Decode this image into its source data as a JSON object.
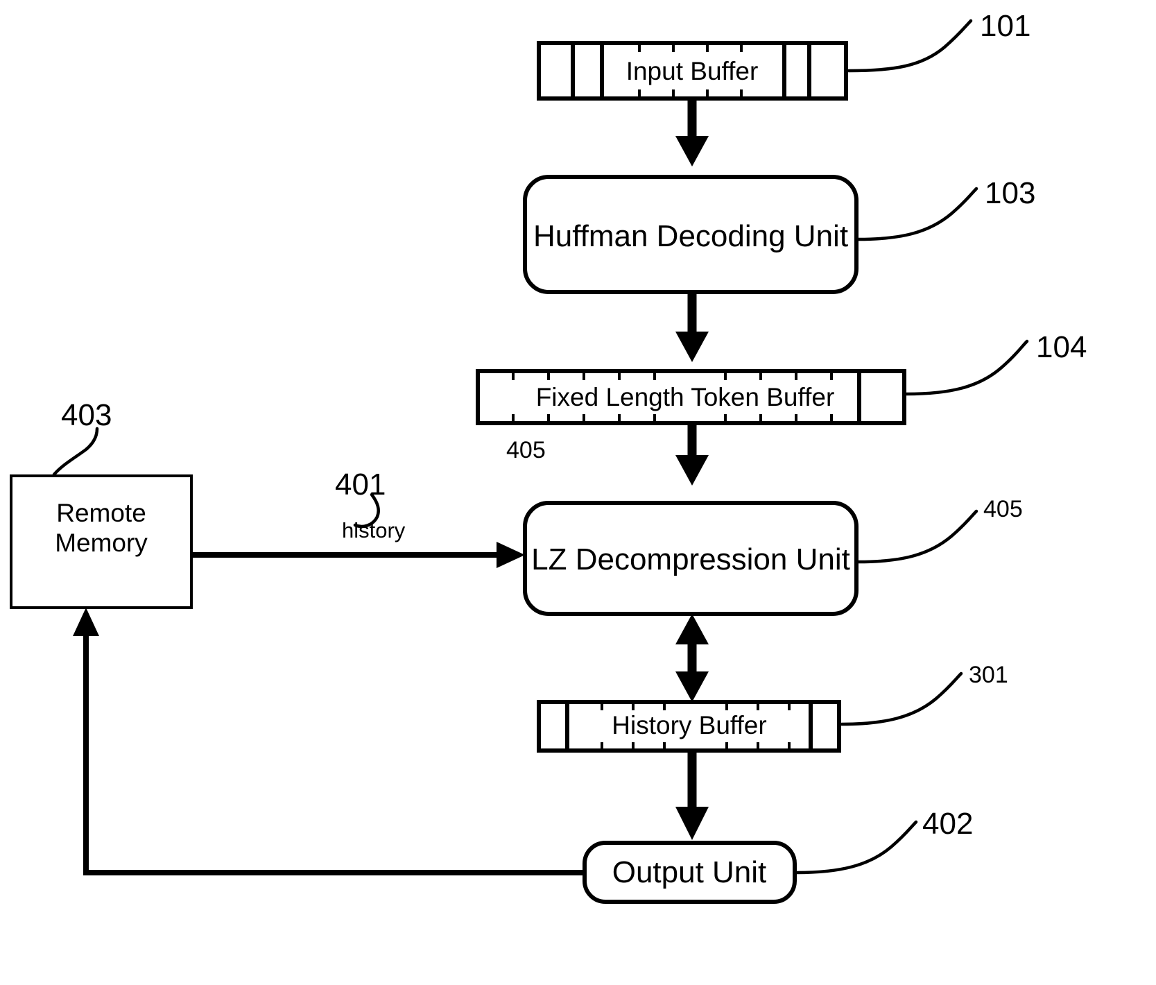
{
  "diagram": {
    "title": "LZ/Huffman Decompression Pipeline Block Diagram",
    "background_color": "#ffffff",
    "line_color": "#000000"
  },
  "blocks": {
    "input_buffer": {
      "label": "Input Buffer",
      "shape": "segmented-rectangle",
      "ref": "101"
    },
    "huffman_unit": {
      "label": "Huffman Decoding Unit",
      "shape": "rounded-rectangle",
      "ref": "103"
    },
    "token_buffer": {
      "label": "Fixed Length Token Buffer",
      "shape": "segmented-rectangle",
      "ref": "104"
    },
    "lz_unit": {
      "label": "LZ Decompression Unit",
      "shape": "rounded-rectangle",
      "ref": "405"
    },
    "history_buffer": {
      "label": "History Buffer",
      "shape": "segmented-rectangle",
      "ref": "301"
    },
    "output_unit": {
      "label": "Output Unit",
      "shape": "rounded-rectangle",
      "ref": "402"
    },
    "remote_memory": {
      "label_line1": "Remote",
      "label_line2": "Memory",
      "shape": "rectangle",
      "ref": "403"
    }
  },
  "reference_numerals": {
    "input_buffer": "101",
    "huffman_unit": "103",
    "token_buffer": "104",
    "token_buffer_lower": "405",
    "lz_unit": "405",
    "history_buffer": "301",
    "output_unit": "402",
    "remote_memory": "403",
    "history_path": "401"
  },
  "annotations": {
    "history_label": "history"
  },
  "connections": [
    {
      "from": "input_buffer",
      "to": "huffman_unit",
      "style": "thick-arrow-down"
    },
    {
      "from": "huffman_unit",
      "to": "token_buffer",
      "style": "thick-arrow-down"
    },
    {
      "from": "token_buffer",
      "to": "lz_unit",
      "style": "thick-arrow-down"
    },
    {
      "from": "remote_memory",
      "to": "lz_unit",
      "style": "arrow-right",
      "label": "history"
    },
    {
      "from": "lz_unit",
      "to": "history_buffer",
      "style": "thick-double-arrow-vertical"
    },
    {
      "from": "history_buffer",
      "to": "output_unit",
      "style": "thick-arrow-down"
    },
    {
      "from": "output_unit",
      "to": "remote_memory",
      "style": "arrow-left-up"
    }
  ]
}
